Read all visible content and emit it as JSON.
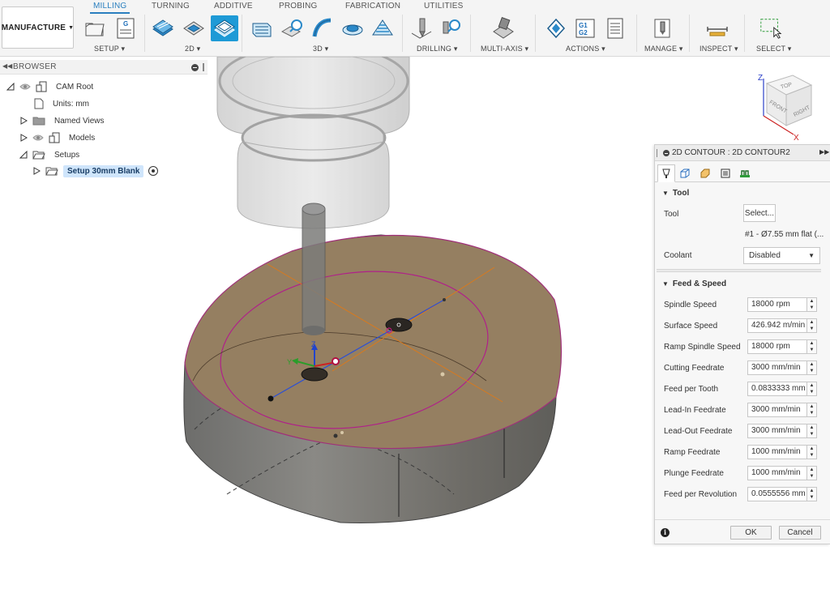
{
  "toolbar": {
    "workspace_label": "MANUFACTURE",
    "tabs": [
      "MILLING",
      "TURNING",
      "ADDITIVE",
      "PROBING",
      "FABRICATION",
      "UTILITIES"
    ],
    "active_tab": "MILLING",
    "groups": [
      "SETUP",
      "2D",
      "3D",
      "DRILLING",
      "MULTI-AXIS",
      "ACTIONS",
      "MANAGE",
      "INSPECT",
      "SELECT"
    ],
    "actions_g1g2": "G1\nG2",
    "accent_color": "#1e9ad6"
  },
  "browser": {
    "title": "BROWSER",
    "items": [
      {
        "label": "CAM Root"
      },
      {
        "label": "Units: mm"
      },
      {
        "label": "Named Views"
      },
      {
        "label": "Models"
      },
      {
        "label": "Setups"
      },
      {
        "label": "Setup 30mm Blank"
      }
    ]
  },
  "viewcube": {
    "z_label": "Z",
    "x_label": "X",
    "top": "TOP",
    "front": "FRONT",
    "right": "RIGHT"
  },
  "triad": {
    "z": "Z",
    "y": "Y"
  },
  "dialog": {
    "title": "2D CONTOUR : 2D CONTOUR2",
    "tool_section": "Tool",
    "tool_label": "Tool",
    "select_button": "Select...",
    "tool_info": "#1 - Ø7.55 mm flat (...",
    "coolant_label": "Coolant",
    "coolant_value": "Disabled",
    "feed_section": "Feed & Speed",
    "fields": [
      {
        "label": "Spindle Speed",
        "value": "18000 rpm"
      },
      {
        "label": "Surface Speed",
        "value": "426.942 m/min"
      },
      {
        "label": "Ramp Spindle Speed",
        "value": "18000 rpm"
      },
      {
        "label": "Cutting Feedrate",
        "value": "3000 mm/min"
      },
      {
        "label": "Feed per Tooth",
        "value": "0.0833333 mm"
      },
      {
        "label": "Lead-In Feedrate",
        "value": "3000 mm/min"
      },
      {
        "label": "Lead-Out Feedrate",
        "value": "3000 mm/min"
      },
      {
        "label": "Ramp Feedrate",
        "value": "1000 mm/min"
      },
      {
        "label": "Plunge Feedrate",
        "value": "1000 mm/min"
      },
      {
        "label": "Feed per Revolution",
        "value": "0.0555556 mm"
      }
    ],
    "ok_label": "OK",
    "cancel_label": "Cancel"
  }
}
